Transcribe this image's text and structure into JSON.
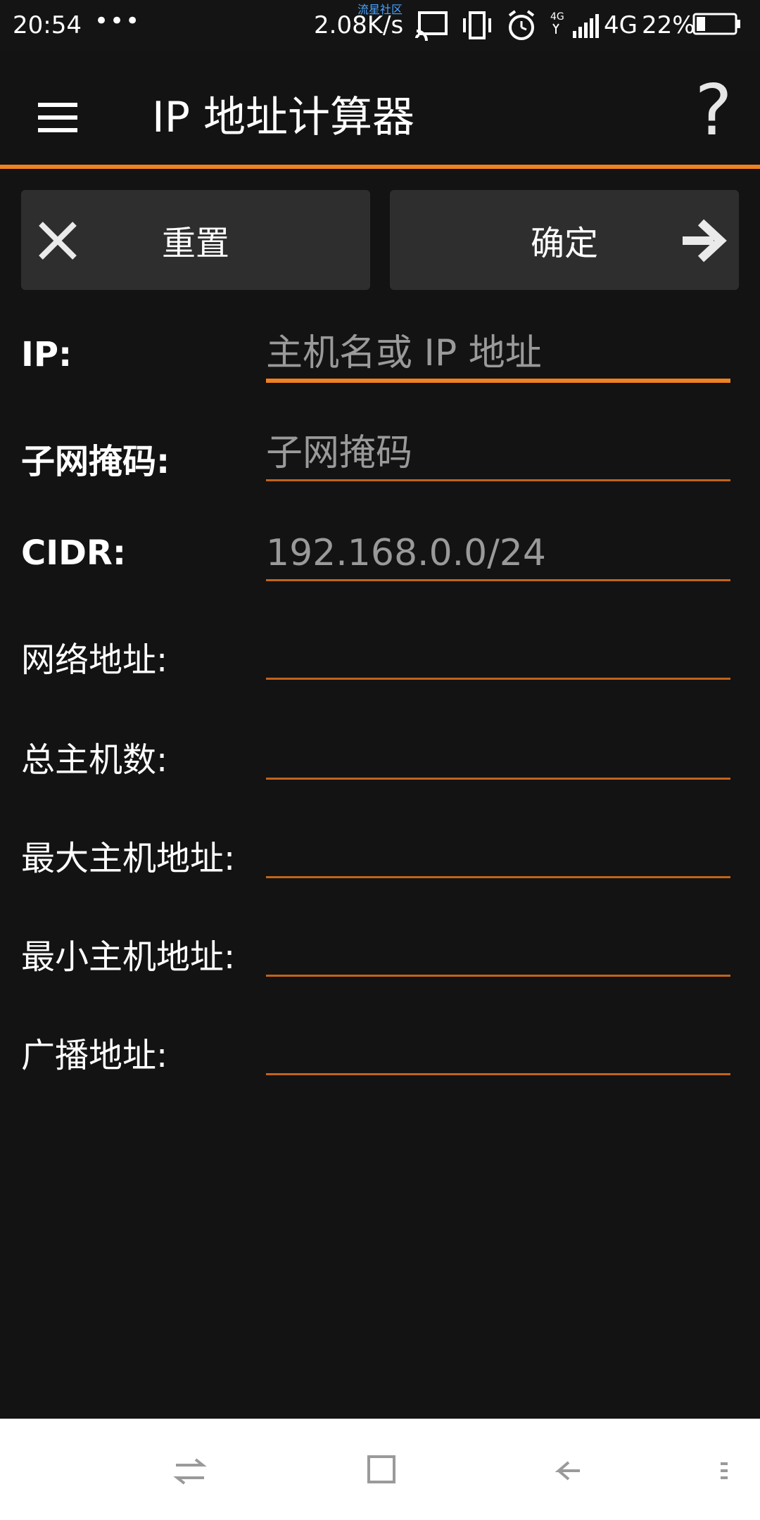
{
  "status_bar": {
    "time": "20:54",
    "dots": "•••",
    "watermark": "流星社区",
    "speed": "2.08K/s",
    "network": "4G",
    "battery": "22%"
  },
  "app_bar": {
    "title": "IP 地址计算器",
    "help": "?"
  },
  "actions": {
    "reset_label": "重置",
    "ok_label": "确定"
  },
  "form": {
    "ip": {
      "label": "IP:",
      "value": "",
      "placeholder": "主机名或 IP 地址"
    },
    "mask": {
      "label": "子网掩码:",
      "value": "",
      "placeholder": "子网掩码"
    },
    "cidr": {
      "label": "CIDR:",
      "value": "",
      "placeholder": "192.168.0.0/24"
    },
    "network_address": {
      "label": "网络地址:",
      "value": ""
    },
    "total_hosts": {
      "label": "总主机数:",
      "value": ""
    },
    "max_host": {
      "label": "最大主机地址:",
      "value": ""
    },
    "min_host": {
      "label": "最小主机地址:",
      "value": ""
    },
    "broadcast": {
      "label": "广播地址:",
      "value": ""
    }
  },
  "colors": {
    "accent": "#f08120",
    "background": "#131313",
    "button": "#2e2e2e"
  },
  "icons": {
    "menu": "menu-icon",
    "help": "help-icon",
    "close": "close-icon",
    "arrow": "arrow-right-icon"
  }
}
